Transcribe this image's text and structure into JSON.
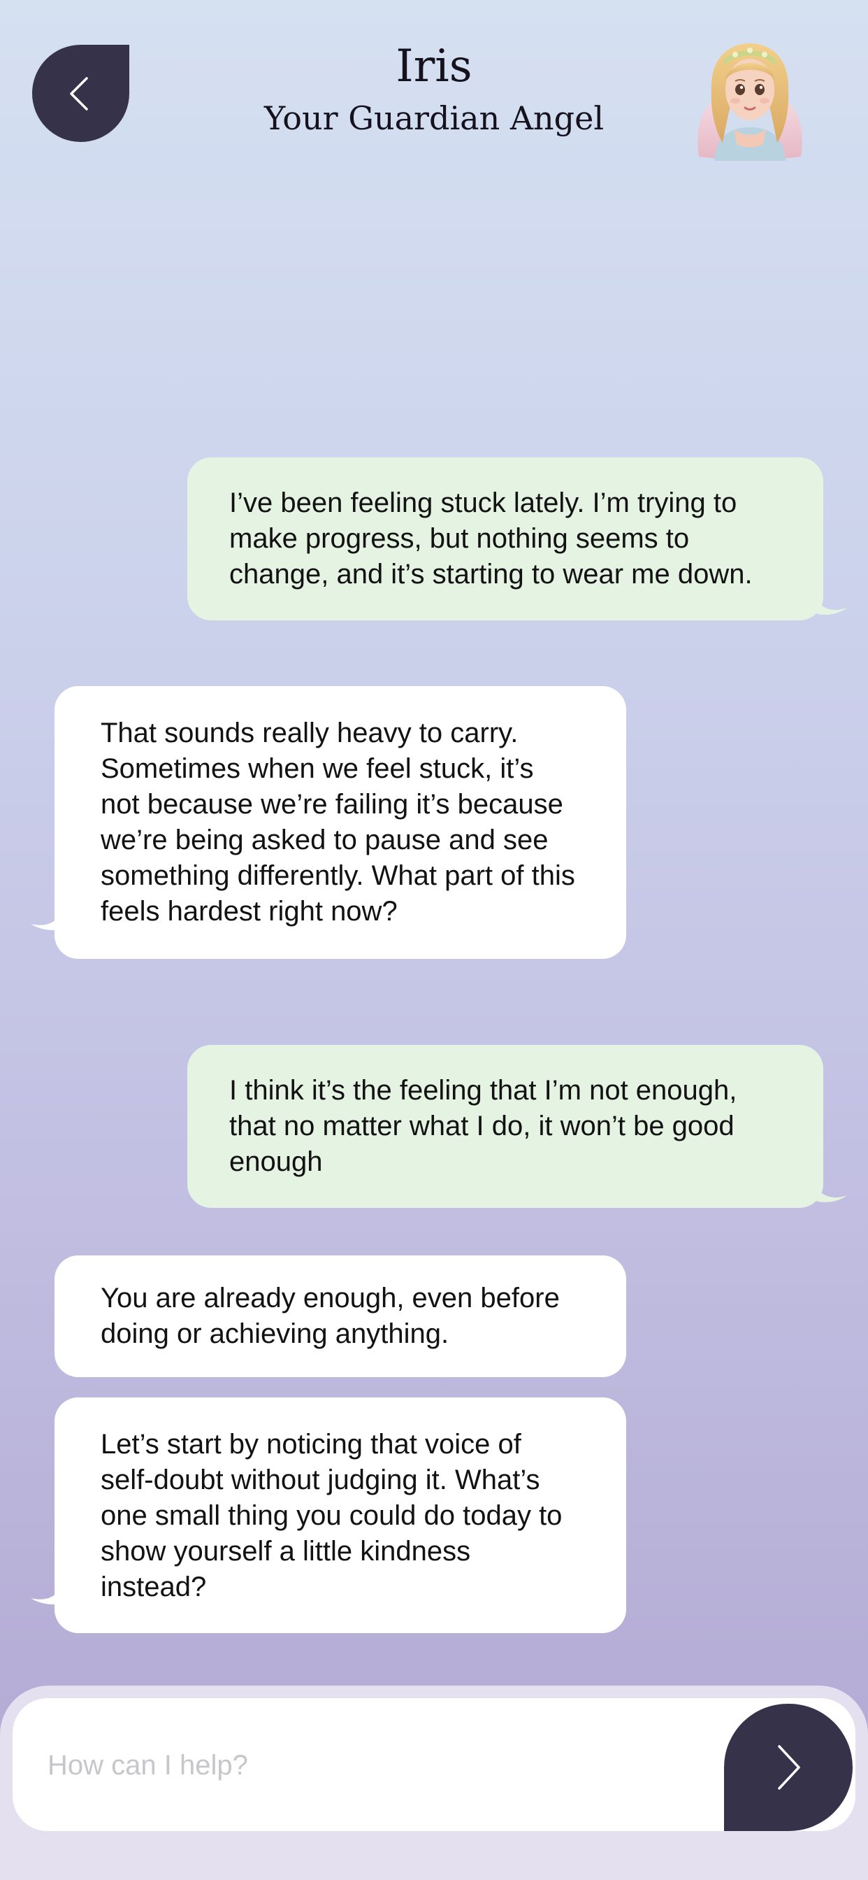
{
  "header": {
    "back_icon": "chevron-left-icon",
    "name": "Iris",
    "subtitle": "Your Guardian Angel",
    "avatar_icon": "angel-avatar"
  },
  "messages": [
    {
      "sender": "user",
      "text": "I’ve been feeling stuck lately. I’m trying to make progress, but nothing seems to change, and it’s starting to wear me down."
    },
    {
      "sender": "assistant",
      "text": "That sounds really heavy to carry. Sometimes when we feel stuck, it’s not because we’re failing it’s because we’re being asked to pause and see something differently. What part of this feels hardest right now?"
    },
    {
      "sender": "user",
      "text": "I think it’s the feeling that I’m not enough, that no matter what I do, it won’t be good enough"
    },
    {
      "sender": "assistant",
      "text": "You are already enough, even before doing or achieving anything."
    },
    {
      "sender": "assistant",
      "text": "Let’s start by noticing that voice of self-doubt without judging it. What’s one small thing you could do today to show yourself a little kindness instead?"
    }
  ],
  "composer": {
    "placeholder": "How can I help?",
    "send_icon": "chevron-right-icon"
  },
  "colors": {
    "accent_dark": "#35324a",
    "user_bubble": "#e5f3e2",
    "assistant_bubble": "#ffffff"
  }
}
